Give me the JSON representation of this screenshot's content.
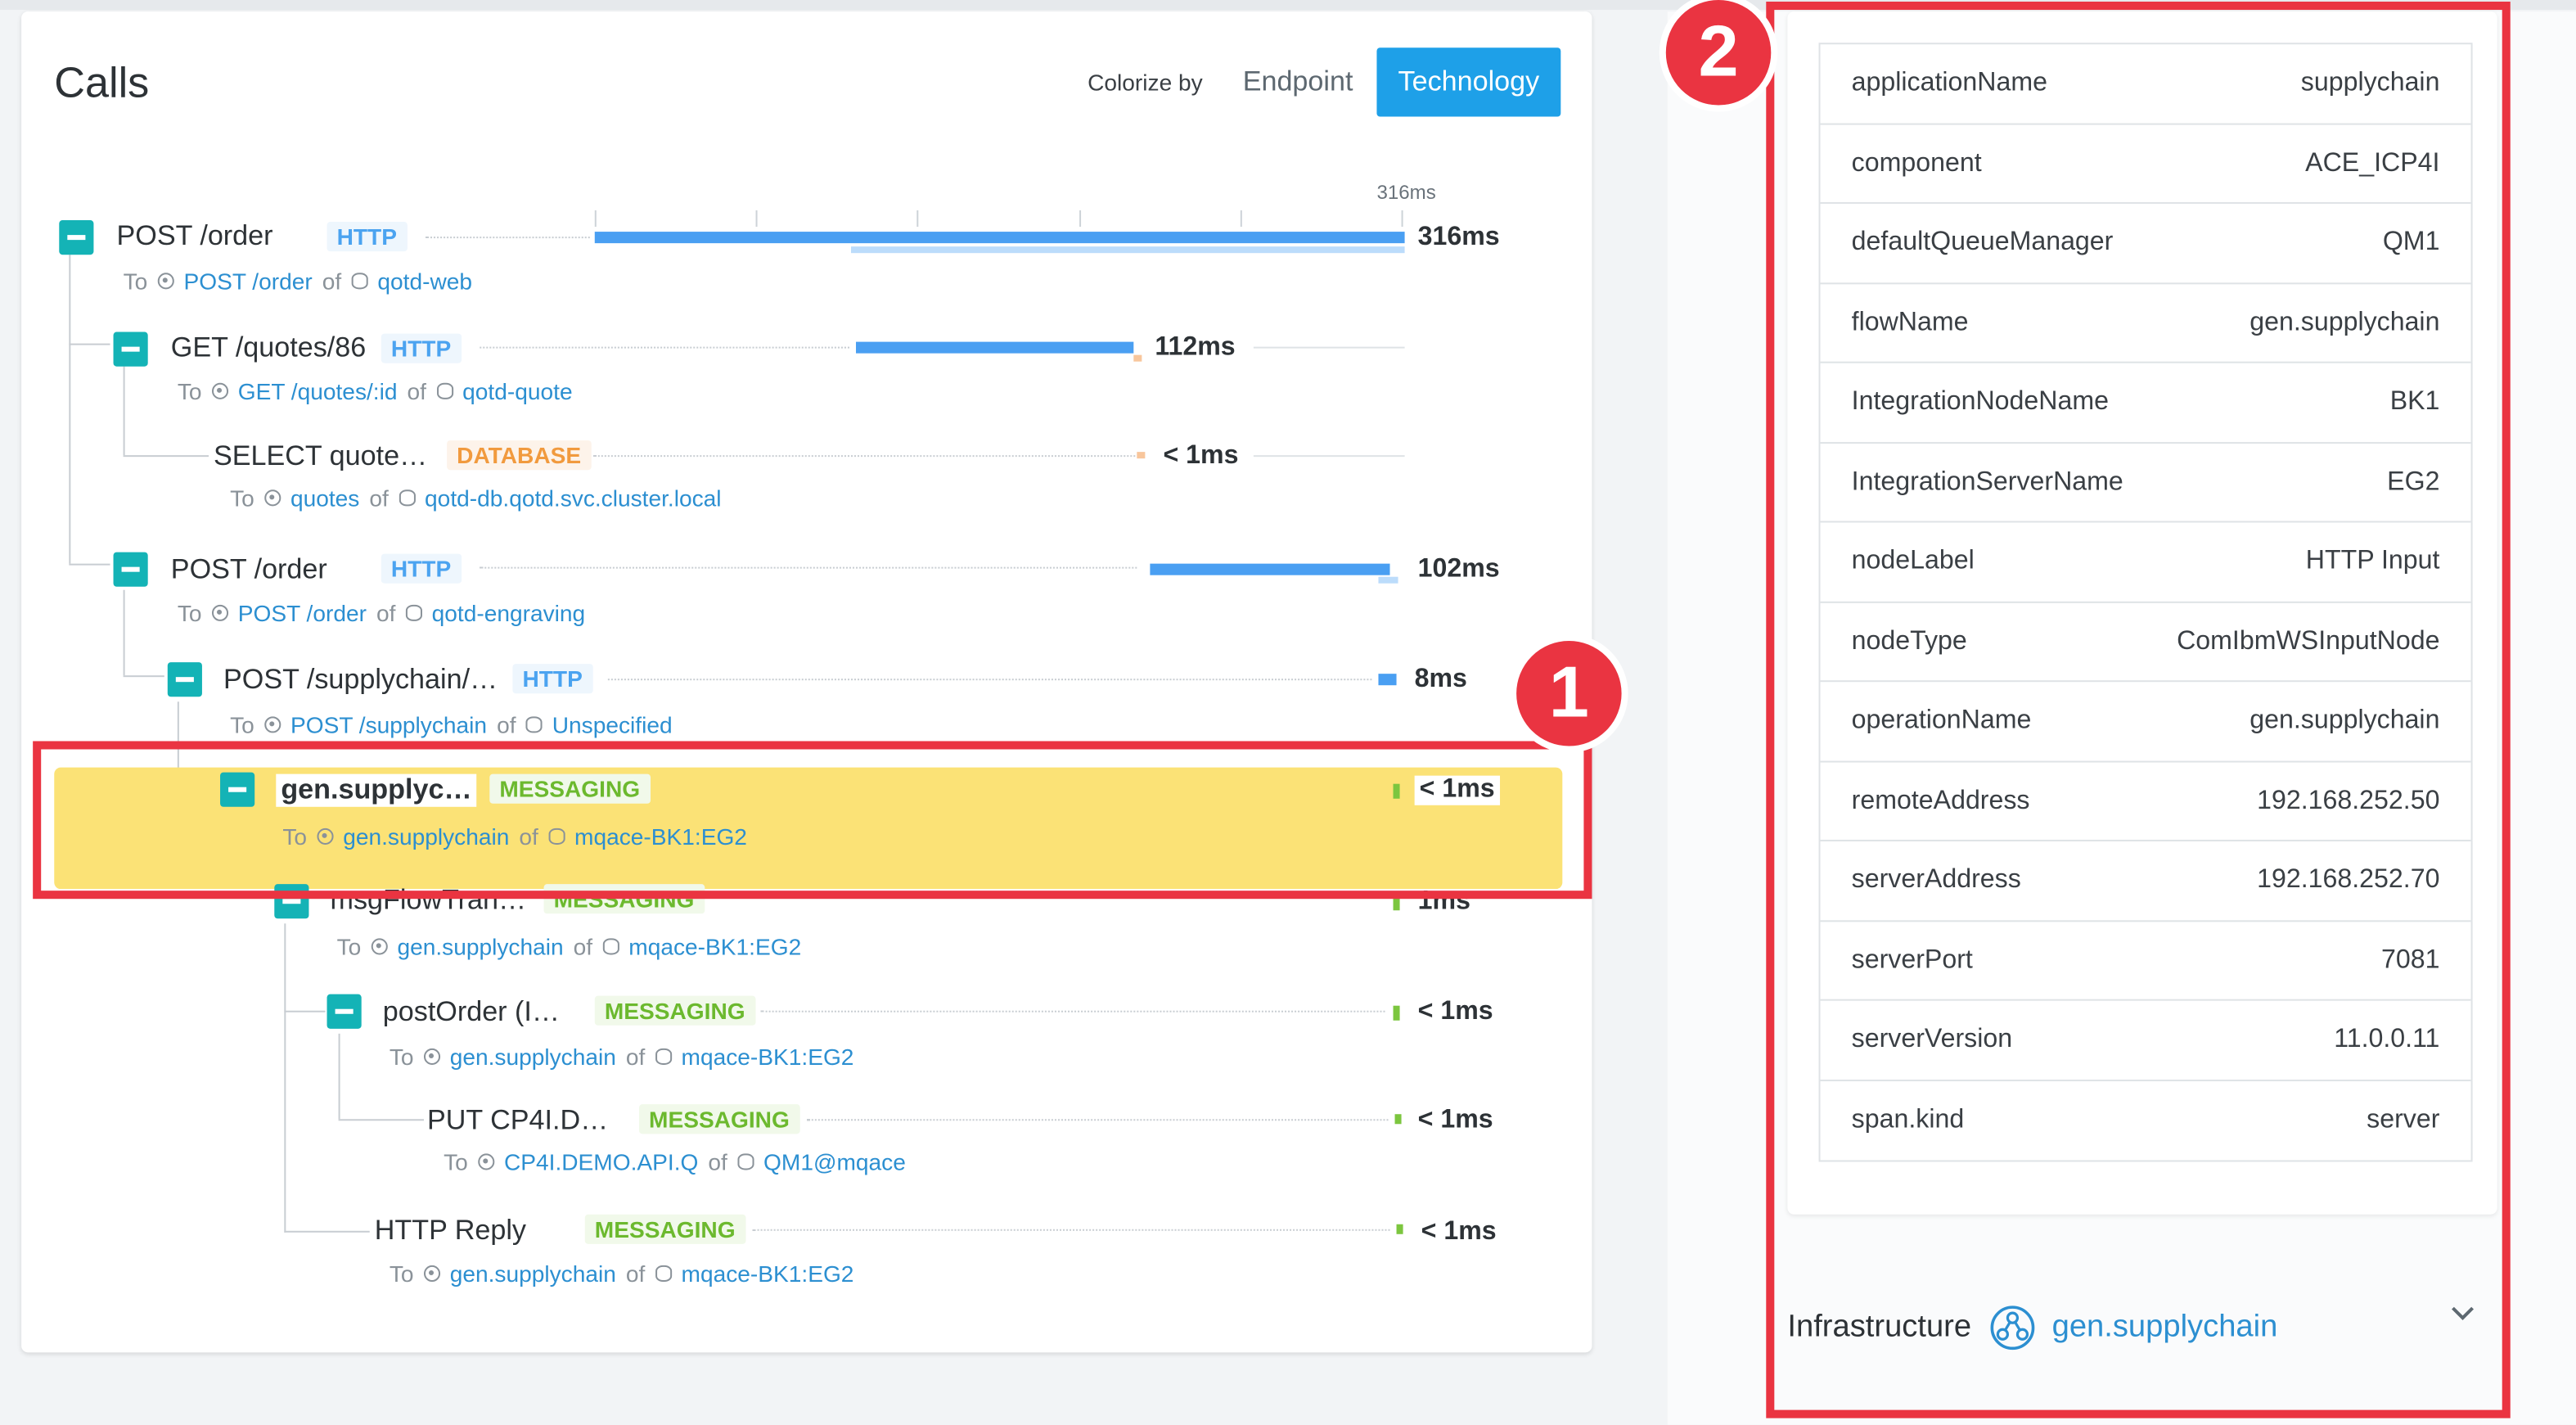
{
  "calls": {
    "title": "Calls",
    "colorize_label": "Colorize by",
    "btn_endpoint": "Endpoint",
    "btn_technology": "Technology",
    "timeline_max": "316ms",
    "to_word": "To",
    "of_word": "of",
    "rows": [
      {
        "name": "POST /order",
        "badge": "HTTP",
        "duration": "316ms",
        "endpoint": "POST /order",
        "service": "qotd-web"
      },
      {
        "name": "GET /quotes/86",
        "badge": "HTTP",
        "duration": "112ms",
        "endpoint": "GET /quotes/:id",
        "service": "qotd-quote"
      },
      {
        "name": "SELECT quote…",
        "badge": "DATABASE",
        "duration": "< 1ms",
        "endpoint": "quotes",
        "service": "qotd-db.qotd.svc.cluster.local"
      },
      {
        "name": "POST /order",
        "badge": "HTTP",
        "duration": "102ms",
        "endpoint": "POST /order",
        "service": "qotd-engraving"
      },
      {
        "name": "POST /supplychain/…",
        "badge": "HTTP",
        "duration": "8ms",
        "endpoint": "POST /supplychain",
        "service": "Unspecified"
      },
      {
        "name": "gen.supplyc…",
        "badge": "MESSAGING",
        "duration": "< 1ms",
        "endpoint": "gen.supplychain",
        "service": "mqace-BK1:EG2"
      },
      {
        "name": "msgFlowTran…",
        "badge": "MESSAGING",
        "duration": "1ms",
        "endpoint": "gen.supplychain",
        "service": "mqace-BK1:EG2"
      },
      {
        "name": "postOrder (I…",
        "badge": "MESSAGING",
        "duration": "< 1ms",
        "endpoint": "gen.supplychain",
        "service": "mqace-BK1:EG2"
      },
      {
        "name": "PUT CP4I.D…",
        "badge": "MESSAGING",
        "duration": "< 1ms",
        "endpoint": "CP4I.DEMO.API.Q",
        "service": "QM1@mqace"
      },
      {
        "name": "HTTP Reply",
        "badge": "MESSAGING",
        "duration": "< 1ms",
        "endpoint": "gen.supplychain",
        "service": "mqace-BK1:EG2"
      }
    ]
  },
  "callouts": {
    "one": "1",
    "two": "2"
  },
  "tags": [
    {
      "key": "applicationName",
      "value": "supplychain"
    },
    {
      "key": "component",
      "value": "ACE_ICP4I"
    },
    {
      "key": "defaultQueueManager",
      "value": "QM1"
    },
    {
      "key": "flowName",
      "value": "gen.supplychain"
    },
    {
      "key": "IntegrationNodeName",
      "value": "BK1"
    },
    {
      "key": "IntegrationServerName",
      "value": "EG2"
    },
    {
      "key": "nodeLabel",
      "value": "HTTP Input"
    },
    {
      "key": "nodeType",
      "value": "ComIbmWSInputNode"
    },
    {
      "key": "operationName",
      "value": "gen.supplychain"
    },
    {
      "key": "remoteAddress",
      "value": "192.168.252.50"
    },
    {
      "key": "serverAddress",
      "value": "192.168.252.70"
    },
    {
      "key": "serverPort",
      "value": "7081"
    },
    {
      "key": "serverVersion",
      "value": "11.0.0.11"
    },
    {
      "key": "span.kind",
      "value": "server"
    }
  ],
  "infrastructure": {
    "label": "Infrastructure",
    "link": "gen.supplychain"
  },
  "colors": {
    "accent": "#1ea0e8",
    "callout": "#ea3441",
    "selected": "#fbe276",
    "toggle": "#14b3b6"
  }
}
